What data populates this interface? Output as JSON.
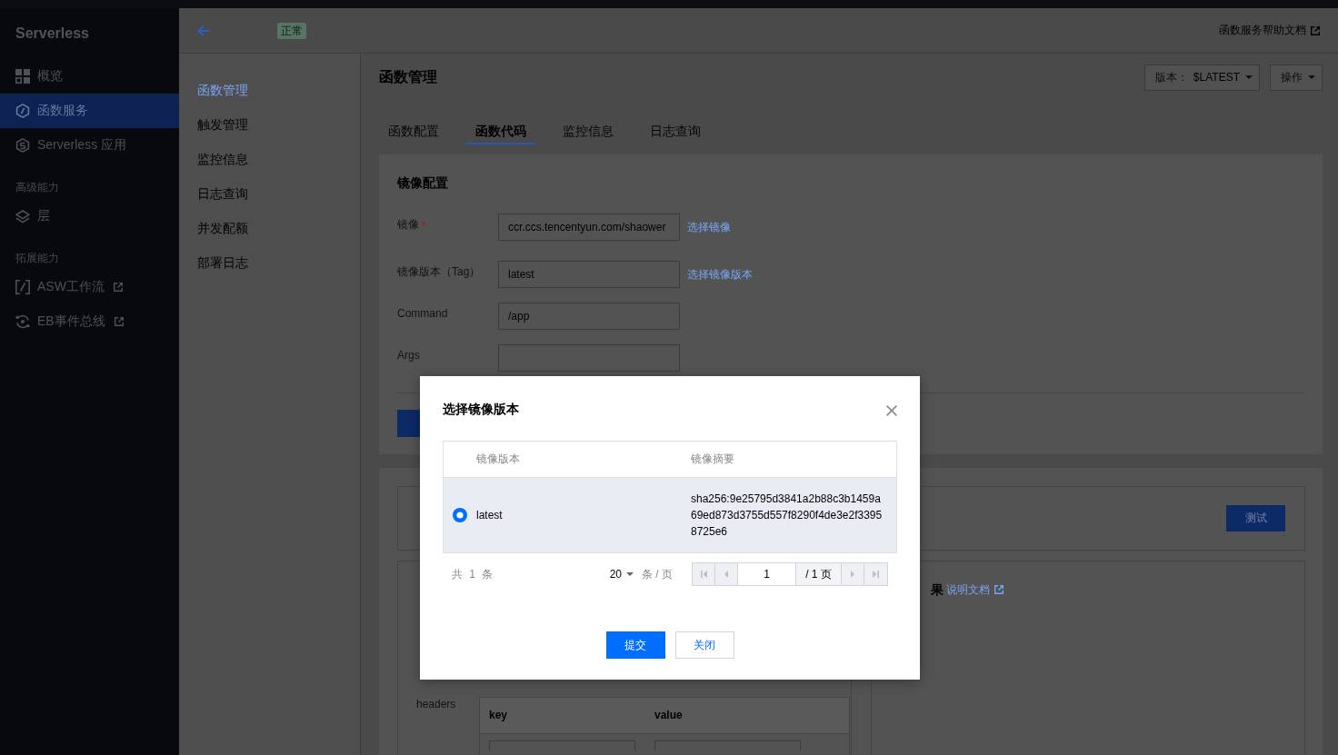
{
  "sidebar": {
    "title": "Serverless",
    "groups": [
      {
        "items": [
          {
            "label": "概览",
            "selected": false,
            "external": false
          },
          {
            "label": "函数服务",
            "selected": true,
            "external": false
          },
          {
            "label": "Serverless 应用",
            "selected": false,
            "external": false
          }
        ]
      },
      {
        "heading": "高级能力",
        "items": [
          {
            "label": "层",
            "selected": false,
            "external": false
          }
        ]
      },
      {
        "heading": "拓展能力",
        "items": [
          {
            "label": "ASW工作流",
            "selected": false,
            "external": true
          },
          {
            "label": "EB事件总线",
            "selected": false,
            "external": true
          }
        ]
      }
    ]
  },
  "header": {
    "status": "正常",
    "help_link": "函数服务帮助文档"
  },
  "subnav": {
    "items": [
      {
        "label": "函数管理",
        "selected": true
      },
      {
        "label": "触发管理",
        "selected": false
      },
      {
        "label": "监控信息",
        "selected": false
      },
      {
        "label": "日志查询",
        "selected": false
      },
      {
        "label": "并发配额",
        "selected": false
      },
      {
        "label": "部署日志",
        "selected": false
      }
    ]
  },
  "page": {
    "title": "函数管理",
    "version_label": "版本：",
    "version_value": "$LATEST",
    "actions": "操作"
  },
  "tabs": [
    {
      "label": "函数配置",
      "selected": false
    },
    {
      "label": "函数代码",
      "selected": true
    },
    {
      "label": "监控信息",
      "selected": false
    },
    {
      "label": "日志查询",
      "selected": false
    }
  ],
  "image_config": {
    "title": "镜像配置",
    "fields": [
      {
        "label": "镜像",
        "required": true,
        "value": "ccr.ccs.tencentyun.com/shaower",
        "link": "选择镜像"
      },
      {
        "label": "镜像版本（Tag）",
        "required": false,
        "value": "latest",
        "link": "选择镜像版本"
      },
      {
        "label": "Command",
        "required": false,
        "value": "/app"
      },
      {
        "label": "Args",
        "required": false
      }
    ]
  },
  "test": {
    "button": "测试"
  },
  "params_panel": {
    "headers_label": "headers",
    "columns": [
      "key",
      "value"
    ]
  },
  "result_panel": {
    "title": "果",
    "link": "说明文档"
  },
  "dialog": {
    "title": "选择镜像版本",
    "columns": [
      "镜像版本",
      "镜像摘要"
    ],
    "rows": [
      {
        "version": "latest",
        "digest": "sha256:9e25795d3841a2b88c3b1459a69ed873d3755d557f8290f4de3e2f33958725e6",
        "selected": true
      }
    ],
    "pagination": {
      "total": "共 1 条",
      "page_size": "20",
      "page_size_unit": "条 / 页",
      "page": "1",
      "page_count": "/ 1 页"
    },
    "buttons": [
      {
        "label": "提交",
        "kind": "primary"
      },
      {
        "label": "关闭",
        "kind": "secondary"
      }
    ]
  }
}
